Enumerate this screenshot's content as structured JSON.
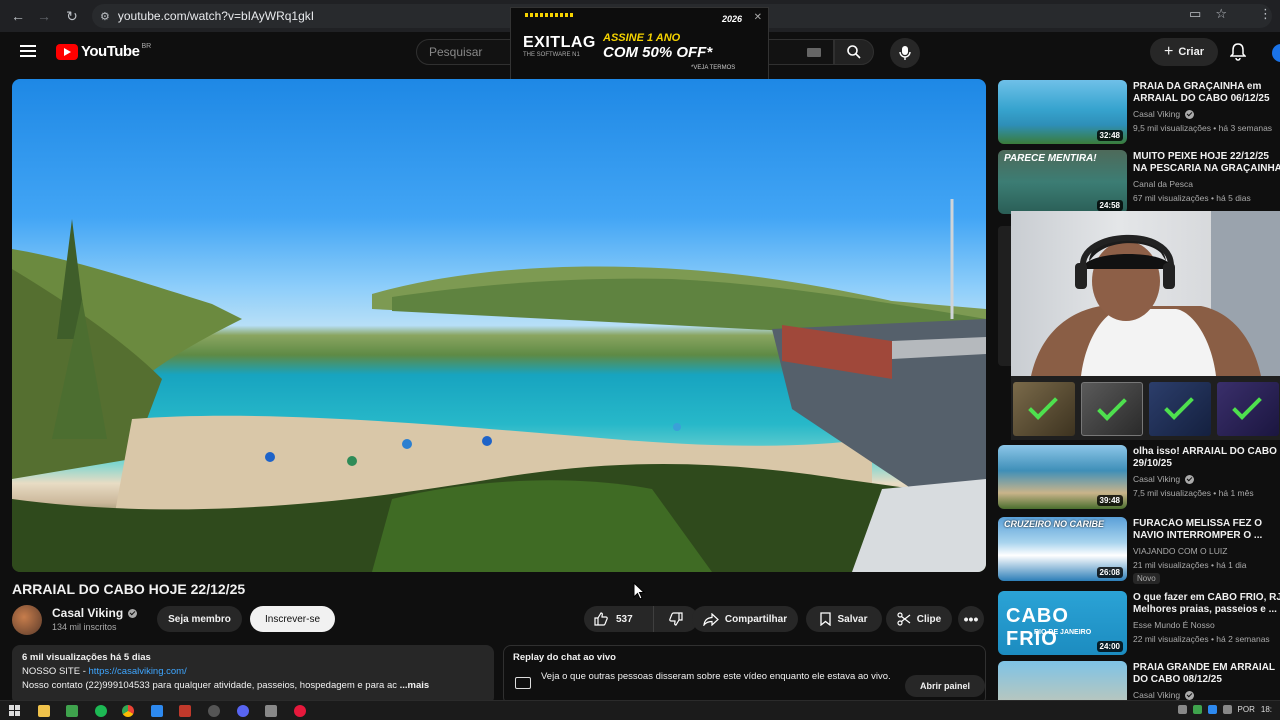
{
  "browser": {
    "url": "youtube.com/watch?v=bIAyWRq1gkI"
  },
  "ad": {
    "brand": "EXITLAG",
    "tagline": "THE SOFTWARE N1",
    "line1": "ASSINE 1 ANO",
    "line2": "COM 50% OFF*",
    "line3": "*VEJA TERMOS",
    "badge": "2026"
  },
  "masthead": {
    "logo_text": "YouTube",
    "country": "BR",
    "search_placeholder": "Pesquisar",
    "create_label": "Criar"
  },
  "video": {
    "title": "ARRAIAL DO CABO HOJE 22/12/25",
    "channel": "Casal Viking",
    "subscribers": "134 mil inscritos",
    "member_label": "Seja membro",
    "subscribe_label": "Inscrever-se",
    "likes": "537",
    "share_label": "Compartilhar",
    "save_label": "Salvar",
    "clip_label": "Clipe",
    "more_label": "•••"
  },
  "description": {
    "meta": "6 mil visualizações  há 5 dias",
    "site_prefix": "NOSSO SITE - ",
    "site_link": "https://casalviking.com/",
    "contact": "Nosso contato (22)999104533 para qualquer atividade, passeios, hospedagem e para ac",
    "more": "...mais"
  },
  "chat": {
    "header": "Replay do chat ao vivo",
    "text": "Veja o que outras pessoas disseram sobre este vídeo enquanto ele estava ao vivo.",
    "button": "Abrir painel"
  },
  "recommendations": [
    {
      "title1": "PRAIA DA GRAÇAINHA em",
      "title2": "ARRAIAL DO CABO 06/12/25",
      "channel": "Casal Viking",
      "verified": true,
      "meta": "9,5 mil visualizações • há 3 semanas",
      "duration": "32:48",
      "thumb_text": ""
    },
    {
      "title1": "MUITO PEIXE HOJE 22/12/25",
      "title2": "NA PESCARIA NA GRAÇAINHA...",
      "channel": "Canal da Pesca",
      "verified": false,
      "meta": "67 mil visualizações • há 5 dias",
      "duration": "24:58",
      "thumb_text": "PARECE MENTIRA!"
    },
    {
      "title1": "olha isso! ARRAIAL DO CABO",
      "title2": "29/10/25",
      "channel": "Casal Viking",
      "verified": true,
      "meta": "7,5 mil visualizações • há 1 mês",
      "duration": "39:48",
      "thumb_text": ""
    },
    {
      "title1": "FURACÃO MELISSA FEZ O",
      "title2": "NAVIO INTERROMPER O ...",
      "channel": "VIAJANDO COM O LUIZ",
      "verified": false,
      "meta": "21 mil visualizações • há 1 dia",
      "duration": "26:08",
      "thumb_text": "CRUZEIRO NO CARIBE",
      "badge": "Novo"
    },
    {
      "title1": "O que fazer em CABO FRIO, RJ",
      "title2": "Melhores praias, passeios e ...",
      "channel": "Esse Mundo É Nosso",
      "verified": false,
      "meta": "22 mil visualizações • há 2 semanas",
      "duration": "24:00",
      "thumb_text": "CABO FRIO"
    },
    {
      "title1": "PRAIA GRANDE EM ARRAIAL",
      "title2": "DO CABO 08/12/25",
      "channel": "Casal Viking",
      "verified": true,
      "meta": "",
      "duration": "",
      "thumb_text": ""
    }
  ],
  "thumb_caption": "RIO DE JANEIRO",
  "taskbar": {
    "lang": "POR",
    "time": "18:"
  }
}
